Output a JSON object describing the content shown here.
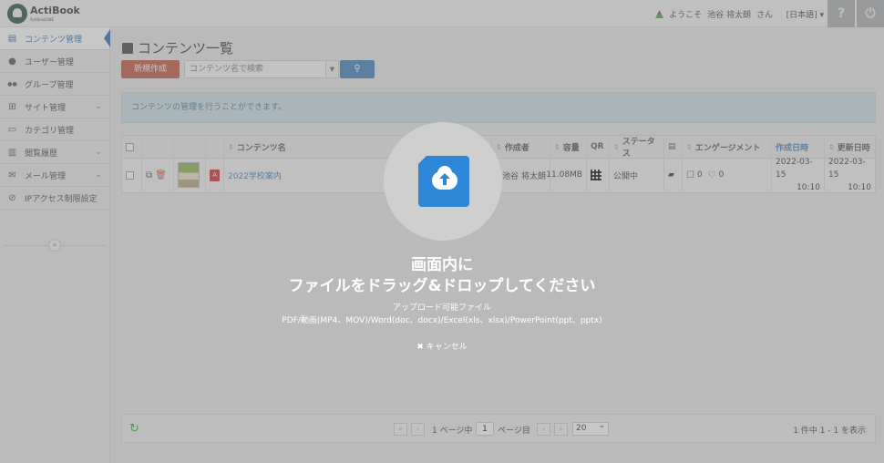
{
  "header": {
    "logo_text": "ActiBook",
    "logo_sub": "ActiBookONE",
    "welcome_prefix": "ようこそ",
    "user_name": "池谷 将太朗",
    "welcome_suffix": "さん",
    "language": "[日本語]",
    "help_symbol": "?",
    "power_symbol": "⏻"
  },
  "sidebar": {
    "items": [
      {
        "label": "コンテンツ管理",
        "icon": "book-icon",
        "glyph": "▤"
      },
      {
        "label": "ユーザー管理",
        "icon": "user-icon",
        "glyph": "●"
      },
      {
        "label": "グループ管理",
        "icon": "group-icon",
        "glyph": "●●"
      },
      {
        "label": "サイト管理",
        "icon": "sitemap-icon",
        "glyph": "⊞"
      },
      {
        "label": "カテゴリ管理",
        "icon": "folder-icon",
        "glyph": "▭"
      },
      {
        "label": "閲覧履歴",
        "icon": "bar-chart-icon",
        "glyph": "▥"
      },
      {
        "label": "メール管理",
        "icon": "mail-icon",
        "glyph": "✉"
      },
      {
        "label": "IPアクセス制限設定",
        "icon": "ban-icon",
        "glyph": "⊘"
      }
    ],
    "collapse_symbol": "«"
  },
  "main": {
    "title": "コンテンツ一覧",
    "new_button": "新規作成",
    "search_placeholder": "コンテンツ名で検索",
    "info": "コンテンツの管理を行うことができます。",
    "table": {
      "headers": {
        "name": "コンテンツ名",
        "author": "作成者",
        "size": "容量",
        "qr": "QR",
        "status": "ステータス",
        "engagement": "エンゲージメント",
        "created": "作成日時",
        "updated": "更新日時"
      },
      "rows": [
        {
          "name": "2022学校案内",
          "author": "池谷 将太朗",
          "size": "11.08MB",
          "status": "公開中",
          "comments": "0",
          "likes": "0",
          "created_date": "2022-03-15",
          "created_time": "10:10",
          "updated_date": "2022-03-15",
          "updated_time": "10:10"
        }
      ]
    },
    "pager": {
      "first": "«",
      "prev": "‹",
      "page_prefix": "1 ページ中",
      "current_page": "1",
      "page_suffix": "ページ目",
      "next": "›",
      "last": "»",
      "per_page": "20",
      "count": "1 件中 1 - 1 を表示"
    }
  },
  "overlay": {
    "title_line1": "画面内に",
    "title_line2": "ファイルをドラッグ&ドロップしてください",
    "allowed_label": "アップロード可能ファイル",
    "allowed_types": "PDF/動画(MP4、MOV)/Word(doc、docx)/Excel(xls、xlsx)/PowerPoint(ppt、pptx)",
    "cancel_label": "キャンセル",
    "cancel_symbol": "✖"
  }
}
